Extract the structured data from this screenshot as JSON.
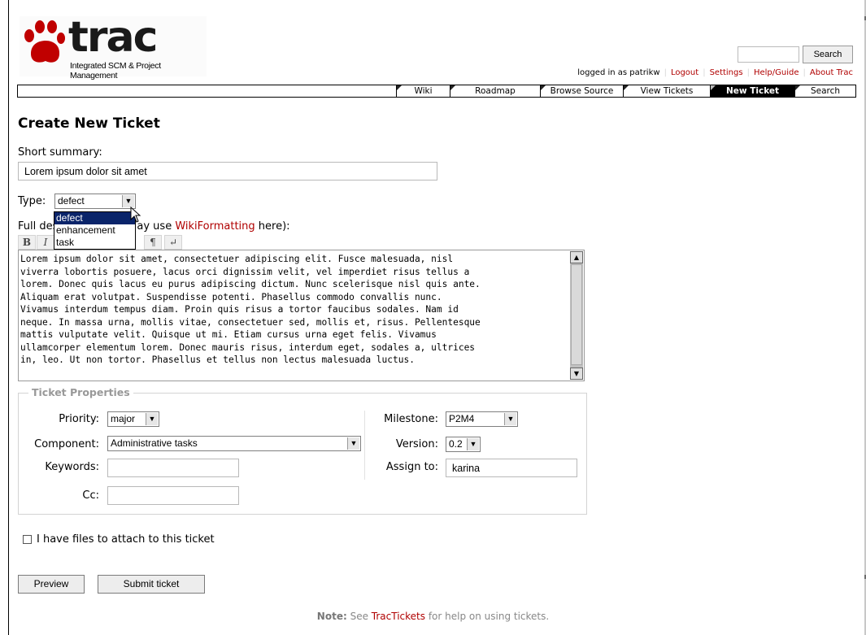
{
  "logo": {
    "word": "trac",
    "subtitle": "Integrated SCM & Project Management"
  },
  "search": {
    "button_label": "Search",
    "value": ""
  },
  "metanav": {
    "logged_in": "logged in as patrikw",
    "items": [
      "Logout",
      "Settings",
      "Help/Guide",
      "About Trac"
    ]
  },
  "mainnav": {
    "items": [
      {
        "label": "Wiki",
        "active": false
      },
      {
        "label": "Roadmap",
        "active": false
      },
      {
        "label": "Browse Source",
        "active": false
      },
      {
        "label": "View Tickets",
        "active": false
      },
      {
        "label": "New Ticket",
        "active": true
      },
      {
        "label": "Search",
        "active": false
      }
    ]
  },
  "page": {
    "title": "Create New Ticket"
  },
  "summary": {
    "label": "Short summary:",
    "value": "Lorem ipsum dolor sit amet"
  },
  "type": {
    "label": "Type:",
    "selected": "defect",
    "options": [
      "defect",
      "enhancement",
      "task"
    ],
    "highlighted": "defect"
  },
  "description": {
    "label_prefix": "Full des",
    "label_middle": "ay use ",
    "link": "WikiFormatting",
    "label_suffix": " here):",
    "toolbar": [
      "B",
      "I",
      "¶",
      "↵"
    ],
    "text": "Lorem ipsum dolor sit amet, consectetuer adipiscing elit. Fusce malesuada, nisl\nviverra lobortis posuere, lacus orci dignissim velit, vel imperdiet risus tellus a\nlorem. Donec quis lacus eu purus adipiscing dictum. Nunc scelerisque nisl quis ante.\nAliquam erat volutpat. Suspendisse potenti. Phasellus commodo convallis nunc.\nVivamus interdum tempus diam. Proin quis risus a tortor faucibus sodales. Nam id\nneque. In massa urna, mollis vitae, consectetuer sed, mollis et, risus. Pellentesque\nmattis vulputate velit. Quisque ut mi. Etiam cursus urna eget felis. Vivamus\nullamcorper elementum lorem. Donec mauris risus, interdum eget, sodales a, ultrices\nin, leo. Ut non tortor. Phasellus et tellus non lectus malesuada luctus."
  },
  "properties": {
    "legend": "Ticket Properties",
    "priority": {
      "label": "Priority:",
      "value": "major"
    },
    "component": {
      "label": "Component:",
      "value": "Administrative tasks"
    },
    "keywords": {
      "label": "Keywords:",
      "value": ""
    },
    "cc": {
      "label": "Cc:",
      "value": ""
    },
    "milestone": {
      "label": "Milestone:",
      "value": "P2M4"
    },
    "version": {
      "label": "Version:",
      "value": "0.2"
    },
    "assign_to": {
      "label": "Assign to:",
      "value": "karina"
    }
  },
  "attach": {
    "label": "I have files to attach to this ticket",
    "checked": false
  },
  "buttons": {
    "preview": "Preview",
    "submit": "Submit ticket"
  },
  "note": {
    "prefix": "Note:",
    "text_before": " See ",
    "link": "TracTickets",
    "text_after": " for help on using tickets."
  },
  "colors": {
    "link": "#b00000",
    "nav_active_bg": "#000000",
    "dropdown_highlight": "#0a246a",
    "legend": "#999999"
  }
}
